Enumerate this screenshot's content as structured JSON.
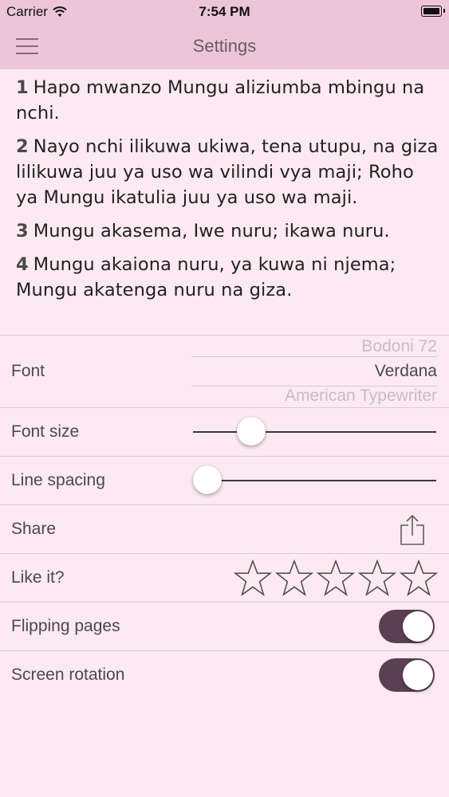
{
  "status_bar": {
    "carrier": "Carrier",
    "time": "7:54 PM",
    "icons": [
      "wifi-icon",
      "battery-icon"
    ]
  },
  "nav": {
    "title": "Settings",
    "menu_icon": "hamburger-menu-icon"
  },
  "verses": [
    {
      "num": "1",
      "text": "Hapo mwanzo Mungu aliziumba mbingu na nchi."
    },
    {
      "num": "2",
      "text": "Nayo nchi ilikuwa ukiwa, tena utupu, na giza lilikuwa juu ya uso wa vilindi vya maji; Roho ya Mungu ikatulia juu ya uso wa maji."
    },
    {
      "num": "3",
      "text": "Mungu akasema, Iwe nuru; ikawa nuru."
    },
    {
      "num": "4",
      "text": "Mungu akaiona nuru, ya kuwa ni njema; Mungu akatenga nuru na giza."
    }
  ],
  "settings": {
    "font": {
      "label": "Font",
      "options": [
        "Bodoni 72",
        "Verdana",
        "American Typewriter"
      ],
      "selected": "Verdana"
    },
    "font_size": {
      "label": "Font size",
      "value": 0.24
    },
    "line_spacing": {
      "label": "Line spacing",
      "value": 0.06
    },
    "share": {
      "label": "Share",
      "icon": "share-icon"
    },
    "like": {
      "label": "Like it?",
      "stars_total": 5,
      "stars_filled": 0,
      "icon": "star-icon"
    },
    "flipping_pages": {
      "label": "Flipping pages",
      "on": true
    },
    "screen_rotation": {
      "label": "Screen rotation",
      "on": true
    }
  },
  "colors": {
    "bar": "#ecc6d8",
    "background": "#fde9f1",
    "switch_on": "#5b3f52"
  }
}
